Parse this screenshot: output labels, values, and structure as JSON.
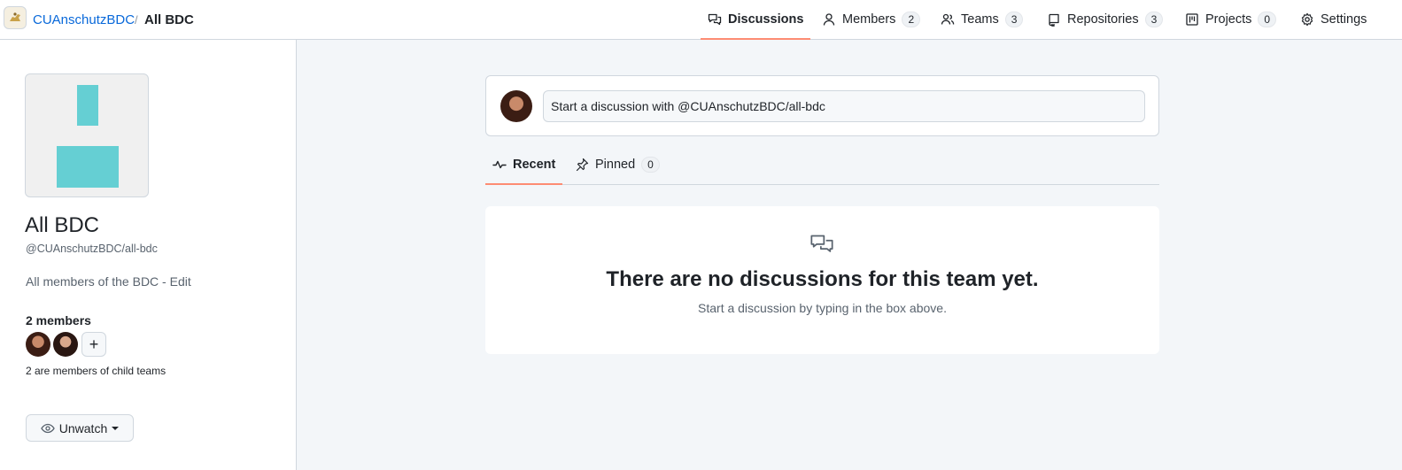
{
  "breadcrumb": {
    "org": "CUAnschutzBDC",
    "separator": "/",
    "team": "All BDC"
  },
  "nav": {
    "discussions": {
      "label": "Discussions",
      "icon": "comment-discussion-icon"
    },
    "members": {
      "label": "Members",
      "count": "2",
      "icon": "person-icon"
    },
    "teams": {
      "label": "Teams",
      "count": "3",
      "icon": "people-icon"
    },
    "repositories": {
      "label": "Repositories",
      "count": "3",
      "icon": "repo-icon"
    },
    "projects": {
      "label": "Projects",
      "count": "0",
      "icon": "project-icon"
    },
    "settings": {
      "label": "Settings",
      "icon": "gear-icon"
    }
  },
  "sidebar": {
    "team_name": "All BDC",
    "team_slug": "@CUAnschutzBDC/all-bdc",
    "description": "All members of the BDC - Edit",
    "members_heading": "2 members",
    "add_member": "+",
    "child_teams_note": "2 are members of child teams",
    "unwatch_label": "Unwatch"
  },
  "composer": {
    "placeholder": "Start a discussion with @CUAnschutzBDC/all-bdc"
  },
  "subtabs": {
    "recent": {
      "label": "Recent",
      "icon": "pulse-icon"
    },
    "pinned": {
      "label": "Pinned",
      "count": "0",
      "icon": "pin-icon"
    }
  },
  "blankslate": {
    "title": "There are no discussions for this team yet.",
    "subtitle": "Start a discussion by typing in the box above."
  },
  "colors": {
    "accent_underline": "#fd8c73",
    "link": "#0969da",
    "identicon": "#65cfd3"
  }
}
